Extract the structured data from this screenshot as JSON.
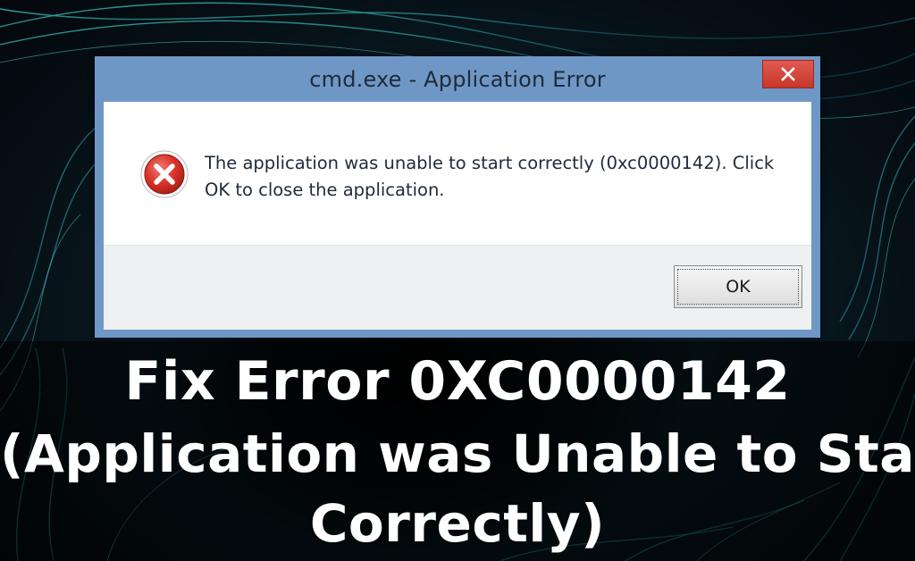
{
  "dialog": {
    "title": "cmd.exe - Application Error",
    "message_line_1": "The application was unable to start correctly (0xc0000142). Click",
    "message_line_2": "OK to close the application.",
    "ok_label": "OK",
    "close_glyph": "✕",
    "icon": "error-icon"
  },
  "caption": {
    "line_1": "Fix Error 0XC0000142",
    "line_2": "(Application was Unable to Start",
    "line_3": "Correctly)"
  },
  "colors": {
    "titlebar": "#6f97c6",
    "close_button": "#c7362b",
    "error_icon": "#c62828",
    "caption_text": "#ffffff"
  }
}
